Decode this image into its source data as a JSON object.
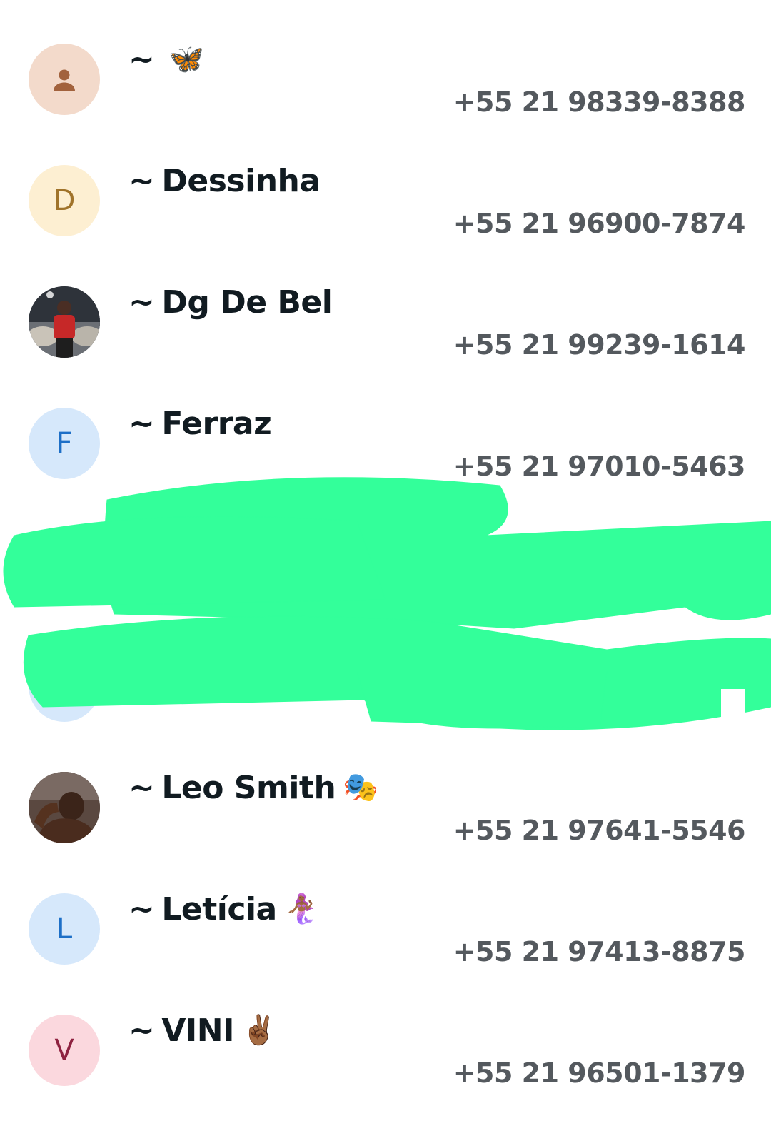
{
  "contacts": [
    {
      "avatar_type": "person-icon",
      "avatar_bg": "#f3dacb",
      "avatar_fg": "#a2623d",
      "initial": "",
      "tilde": "~",
      "name": "",
      "emoji": "🦋",
      "phone": "+55 21 98339-8388"
    },
    {
      "avatar_type": "letter",
      "avatar_bg": "#fdefd2",
      "avatar_fg": "#a0732a",
      "initial": "D",
      "tilde": "~",
      "name": "Dessinha",
      "emoji": "",
      "phone": "+55 21 96900-7874"
    },
    {
      "avatar_type": "photo",
      "avatar_bg": "#3a3f48",
      "avatar_fg": "#c62828",
      "initial": "",
      "tilde": "~",
      "name": "Dg De Bel",
      "emoji": "",
      "phone": "+55 21 99239-1614"
    },
    {
      "avatar_type": "letter",
      "avatar_bg": "#d6e8fb",
      "avatar_fg": "#1d6fc7",
      "initial": "F",
      "tilde": "~",
      "name": "Ferraz",
      "emoji": "",
      "phone": "+55 21 97010-5463"
    },
    {
      "avatar_type": "photo",
      "avatar_bg": "#4b3a34",
      "avatar_fg": "#9a6b52",
      "initial": "",
      "tilde": "~",
      "name": "Leo Smith",
      "emoji": "🎭",
      "phone": "+55 21 97641-5546"
    },
    {
      "avatar_type": "letter",
      "avatar_bg": "#d6e8fb",
      "avatar_fg": "#1d6fc7",
      "initial": "L",
      "tilde": "~",
      "name": "Letícia",
      "emoji": "🧜🏾‍♀️",
      "phone": "+55 21 97413-8875"
    },
    {
      "avatar_type": "letter",
      "avatar_bg": "#fbd8de",
      "avatar_fg": "#8e2240",
      "initial": "V",
      "tilde": "~",
      "name": "VINI",
      "emoji": "✌🏾",
      "phone": "+55 21 96501-1379"
    }
  ],
  "redaction_color": "#33ff9a"
}
